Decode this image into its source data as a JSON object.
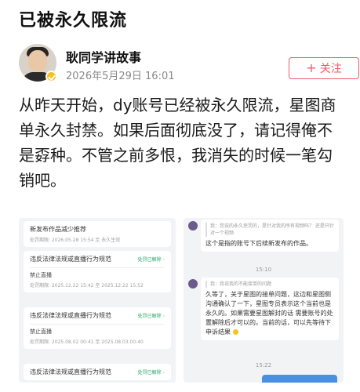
{
  "page": {
    "title": "已被永久限流"
  },
  "author": {
    "name": "耿同学讲故事",
    "meta": "2026年5月29日 16:01",
    "follow_label": "关注",
    "follow_icon": "plus-icon",
    "badge_icon": "verified-check-icon"
  },
  "post": {
    "text": "从昨天开始，dy账号已经被永久限流，星图商单永久封禁。如果后面彻底没了，请记得俺不是孬种。不管之前多恨，我消失的时候一笔勾销吧。"
  },
  "left_image": {
    "card0": {
      "title": "新发布作品减少推荐",
      "sub": "处罚期限: 2026.05.28 15:54 至 永久生效"
    },
    "card1": {
      "title": "违反法律法规或直播行为规范",
      "tag": "处罚已解除",
      "label": "禁止直播",
      "sub": "处罚期限: 2025.12.22 15:42 至 2025.12.22 15:52"
    },
    "card2": {
      "title": "违反法律法规或直播行为规范",
      "tag": "处罚已解除",
      "label": "禁止直播",
      "sub": "处罚期限: 2025.08.02 00:41 至 2025.08.03 00:40"
    },
    "card3": {
      "title": "违反法律法规或直播行为规范",
      "tag": "处罚已解除"
    }
  },
  "right_image": {
    "msg1": {
      "quote": "我：您说的永久惩罚的，是针对我的所有视频吗？ 还是只针对一个视频",
      "text": "这个是指的账号下后续新发布的作品。"
    },
    "time1": "15:10",
    "msg2": {
      "quote": "我：我说我的不能接单的问题",
      "text": "久等了，关于星图的接单问题，这边和星图侧沟通确认了一下，星图专员表示这个当前也是永久的。如果需要星图解封的话 需要账号的处置解除后才可以的。当前的话，可以先等待下申诉结果"
    },
    "time2": "15:22"
  },
  "colors": {
    "accent": "#f05a6a",
    "badge": "#f6c21c",
    "status_green": "#2aa86a",
    "chat_blue": "#4a90e2"
  }
}
